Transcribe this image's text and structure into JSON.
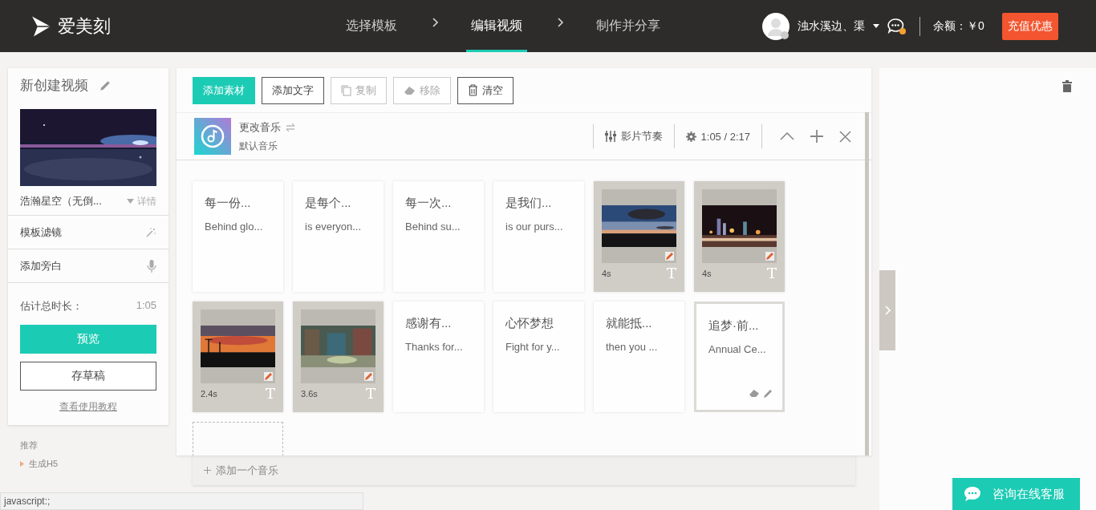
{
  "header": {
    "logo": "爱美刻",
    "steps": [
      {
        "label": "选择模板",
        "selected": false
      },
      {
        "label": "编辑视频",
        "selected": true
      },
      {
        "label": "制作并分享",
        "selected": false
      }
    ],
    "user": {
      "name": "浊水溪边、渠",
      "unread": true
    },
    "balance": "余额：￥0",
    "recharge_button": "充值优惠"
  },
  "sidebar": {
    "title": "新创建视频",
    "template": {
      "name": "浩瀚星空（无倒...",
      "details": "详情"
    },
    "rows": [
      {
        "label": "模板滤镜",
        "kind": "filter"
      },
      {
        "label": "添加旁白",
        "kind": "voice"
      }
    ],
    "duration_label": "估计总时长：",
    "duration": "1:05",
    "preview_button": "预览",
    "draft_button": "存草稿",
    "tutorial_link": "查看使用教程"
  },
  "recommend": {
    "title": "推荐",
    "items": [
      "生成H5"
    ]
  },
  "toolbar": [
    {
      "label": "添加素材",
      "kind": "primary",
      "disabled": false
    },
    {
      "label": "添加文字",
      "kind": "text",
      "disabled": false
    },
    {
      "label": "复制",
      "kind": "copy",
      "disabled": true
    },
    {
      "label": "移除",
      "kind": "remove",
      "disabled": true
    },
    {
      "label": "清空",
      "kind": "clear",
      "disabled": false
    }
  ],
  "music": {
    "title": "更改音乐",
    "subtitle": "默认音乐",
    "rhythm": "影片节奏",
    "time": "1:05 / 2:17"
  },
  "cards": [
    {
      "kind": "text",
      "title": "每一份...",
      "subtitle": "Behind glo...",
      "selected": false
    },
    {
      "kind": "text",
      "title": "是每个...",
      "subtitle": "is everyon...",
      "selected": false
    },
    {
      "kind": "text",
      "title": "每一次...",
      "subtitle": "Behind su...",
      "selected": false
    },
    {
      "kind": "text",
      "title": "是我们...",
      "subtitle": "is our purs...",
      "selected": false
    },
    {
      "kind": "media",
      "duration": "4s",
      "selected": false
    },
    {
      "kind": "media",
      "duration": "4s",
      "selected": false
    },
    {
      "kind": "media",
      "duration": "2.4s",
      "selected": false
    },
    {
      "kind": "media",
      "duration": "3.6s",
      "selected": false
    },
    {
      "kind": "text",
      "title": "感谢有...",
      "subtitle": "Thanks for...",
      "selected": false
    },
    {
      "kind": "text",
      "title": "心怀梦想",
      "subtitle": "Fight for y...",
      "selected": false
    },
    {
      "kind": "text",
      "title": "就能抵...",
      "subtitle": "then you ...",
      "selected": false
    },
    {
      "kind": "text",
      "title": "追梦·前...",
      "subtitle": "Annual Ce...",
      "selected": true
    },
    {
      "kind": "empty"
    }
  ],
  "add_music": "添加一个音乐",
  "support_button": "咨询在线客服",
  "status_bar": "javascript:;"
}
